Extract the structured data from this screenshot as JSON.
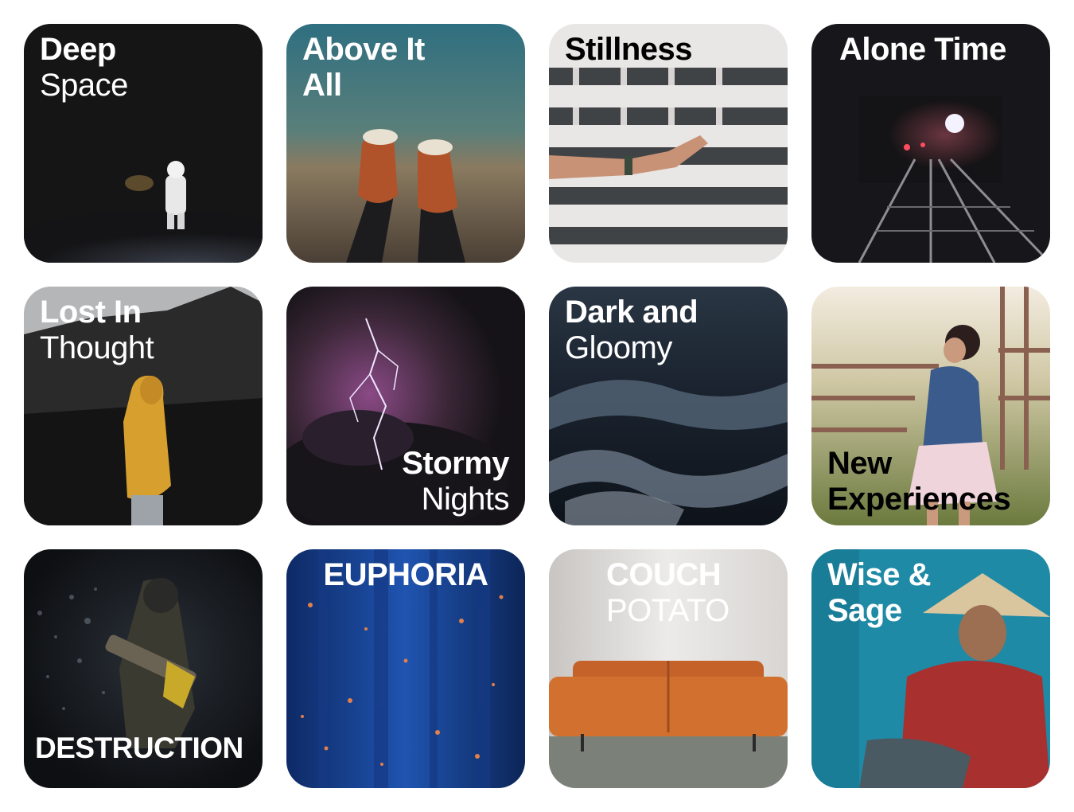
{
  "tiles": [
    {
      "id": "deep-space",
      "bold": "Deep",
      "regular": "Space",
      "image": "astronaut-on-moon"
    },
    {
      "id": "above-it-all",
      "bold": "Above It\nAll",
      "regular": "",
      "image": "feet-over-water"
    },
    {
      "id": "stillness",
      "bold": "Stillness",
      "regular": "",
      "image": "hand-reaching-building"
    },
    {
      "id": "alone-time",
      "bold": "Alone Time",
      "regular": "",
      "image": "subway-tunnel"
    },
    {
      "id": "lost-in-thought",
      "bold": "Lost In",
      "regular": "Thought",
      "image": "person-yellow-hoodie"
    },
    {
      "id": "stormy-nights",
      "bold": "Stormy",
      "regular": "Nights",
      "image": "lightning-clouds"
    },
    {
      "id": "dark-and-gloomy",
      "bold": "Dark and",
      "regular": "Gloomy",
      "image": "dark-ocean-waves"
    },
    {
      "id": "new-experiences",
      "bold": "New\nExperiences",
      "regular": "",
      "image": "girl-at-fence"
    },
    {
      "id": "destruction",
      "bold": "DESTRUCTION",
      "regular": "",
      "image": "disintegrating-soldier"
    },
    {
      "id": "euphoria",
      "bold": "EUPHORIA",
      "regular": "",
      "image": "blue-particles"
    },
    {
      "id": "couch-potato",
      "bold": "COUCH",
      "regular": "POTATO",
      "image": "orange-leather-couch"
    },
    {
      "id": "wise-and-sage",
      "bold": "Wise &\nSage",
      "regular": "",
      "image": "woman-conical-hat"
    }
  ]
}
